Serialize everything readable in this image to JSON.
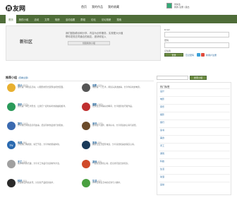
{
  "header": {
    "logo_char": "西",
    "logo_text": "友网",
    "topnav": [
      "首页",
      "我的作品",
      "我的收藏"
    ],
    "user": [
      "刘先生",
      "我的·注册 | 退出"
    ]
  },
  "navbar": {
    "items": [
      "首页",
      "我的小组",
      "活动",
      "文章",
      "相册",
      "活动话题",
      "群组",
      "论坛",
      "论坛相册",
      "搜索"
    ],
    "active": 0
  },
  "hero": {
    "title": "新社区",
    "text": [
      "我们鼓励原创和分享，内容为创作服务，实现更大价值",
      "帮你发现志同道合的朋友，邀请你加入"
    ],
    "button": "创建新的小组"
  },
  "login": {
    "email_label": "Email",
    "password_label": "密码",
    "remember": "记住我",
    "login_button": "登录",
    "forgot": "忘记密码",
    "register": "新用户注册",
    "social_colors": [
      "#3aa0d8",
      "#e04b3c"
    ]
  },
  "list": {
    "title": "推荐小组",
    "more": "(查看全部)",
    "groups": [
      {
        "icon": "",
        "color": "#e8b030",
        "name": "设计 ",
        "count": "(800)",
        "desc": "设计是一种创造活动，以图形的形式展现在视觉层面。"
      },
      {
        "icon": "",
        "color": "#555555",
        "name": "电影 ",
        "count": "(421)",
        "desc": "电影是一门艺术，用镜头讲述故事，分享你喜欢的电影。"
      },
      {
        "icon": "",
        "color": "#2a9a5a",
        "name": "音乐 ",
        "count": "(233)",
        "desc": "音乐是一种艺术形式，让我们一起听好听的歌曲和旋律。"
      },
      {
        "icon": "",
        "color": "#c03030",
        "name": "摄影 ",
        "count": "(180)",
        "desc": "记录生活中美好的瞬间，分享摄影技巧和作品。"
      },
      {
        "icon": "",
        "color": "#3a6ab0",
        "name": "旅行 ",
        "count": "(144)",
        "desc": "分享旅行中的见闻与故事，结识同样热爱旅行的朋友。"
      },
      {
        "icon": "",
        "color": "#6b4b2b",
        "name": "读书 ",
        "count": "(120)",
        "desc": "读书使人进步，推荐好书，分享阅读的心得与感悟。"
      },
      {
        "icon": "TV",
        "color": "#2a6ab0",
        "name": "电视 ",
        "count": "(96)",
        "desc": "讨论热门电视剧、综艺节目，分享你的观看体验。"
      },
      {
        "icon": "",
        "color": "#1a3a5a",
        "name": "美食 ",
        "count": "(88)",
        "desc": "美食让生活更有味道，分享菜谱和美食探店心得。"
      },
      {
        "icon": "",
        "color": "#a0a0a0",
        "name": "手工 ",
        "count": "(74)",
        "desc": "动手制作的乐趣，分享手工作品与创意制作方法。"
      },
      {
        "icon": "",
        "color": "#d04a2a",
        "name": "游戏 ",
        "count": "(63)",
        "desc": "一起交流游戏心得，结识志同道合的玩家。"
      },
      {
        "icon": "",
        "color": "#2a2a2a",
        "name": "科技 ",
        "count": "(52)",
        "desc": "关注前沿科技资讯，讨论新产品和新技术。"
      },
      {
        "icon": "",
        "color": "#4aa040",
        "name": "生活 ",
        "count": "(47)",
        "desc": "分享日常生活中的点滴与小确幸。"
      }
    ]
  },
  "sidebar": {
    "search_button": "搜索小组",
    "title": "热门标签",
    "items": [
      "设计",
      "电影",
      "音乐",
      "摄影",
      "旅行",
      "读书",
      "美食",
      "手工",
      "游戏",
      "科技",
      "生活",
      "动漫",
      "运动"
    ]
  }
}
